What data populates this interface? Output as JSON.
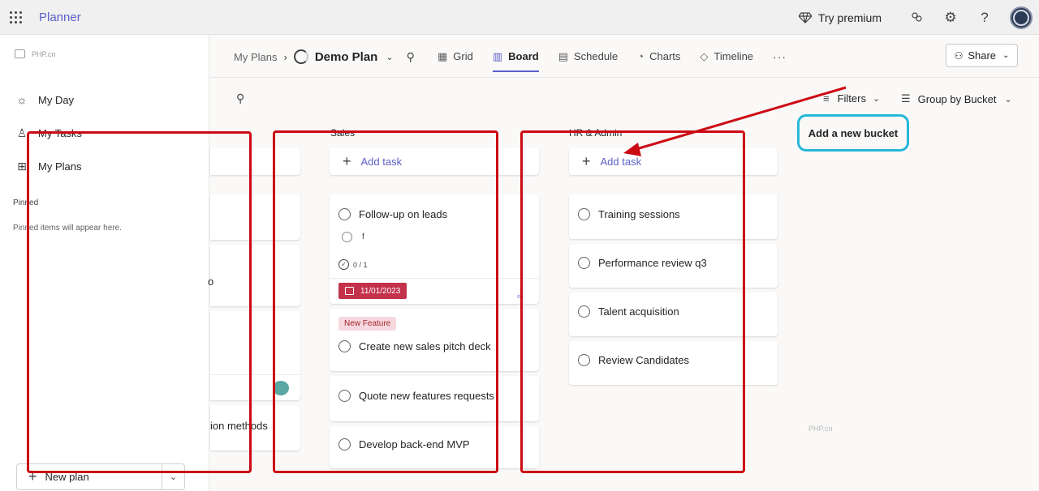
{
  "app": {
    "name": "Planner",
    "try_premium": "Try premium"
  },
  "sidebar": {
    "logo_text": "PHP.cn",
    "items": [
      {
        "label": "My Day",
        "icon": "sun-icon"
      },
      {
        "label": "My Tasks",
        "icon": "person-icon"
      },
      {
        "label": "My Plans",
        "icon": "grid-icon"
      }
    ],
    "pinned_title": "Pinned",
    "pinned_hint": "Pinned items will appear here.",
    "new_plan": "New plan"
  },
  "header": {
    "breadcrumb_root": "My Plans",
    "plan_title": "Demo Plan",
    "tabs": [
      {
        "label": "Grid",
        "active": false
      },
      {
        "label": "Board",
        "active": true
      },
      {
        "label": "Schedule",
        "active": false
      },
      {
        "label": "Charts",
        "active": false
      },
      {
        "label": "Timeline",
        "active": false
      }
    ],
    "more": "···",
    "share": "Share"
  },
  "toolbar": {
    "filters": "Filters",
    "group_by": "Group by Bucket"
  },
  "buckets": [
    {
      "name": "Sales",
      "add_task": "Add task",
      "tasks": [
        {
          "title": "Follow-up on leads",
          "subtask": "f",
          "checklist": "0 / 1",
          "due": "11/01/2023"
        },
        {
          "label": "New Feature",
          "title": "Create new sales pitch deck"
        },
        {
          "title": "Quote new features requests"
        },
        {
          "title": "Develop back-end MVP"
        }
      ]
    },
    {
      "name": "HR & Admin",
      "add_task": "Add task",
      "tasks": [
        {
          "title": "Training sessions"
        },
        {
          "title": "Performance review q3"
        },
        {
          "title": "Talent acquisition"
        },
        {
          "title": "Review Candidates"
        }
      ]
    }
  ],
  "partial_column": {
    "fragment_1": "o",
    "fragment_2": "ion methods"
  },
  "add_bucket": "Add a new bucket",
  "watermark": "PHP.cn",
  "colors": {
    "brand": "#5b5fc7",
    "due_badge": "#c4314b",
    "annotation_red": "#cc0a14",
    "annotation_cyan": "#26b7d8"
  }
}
